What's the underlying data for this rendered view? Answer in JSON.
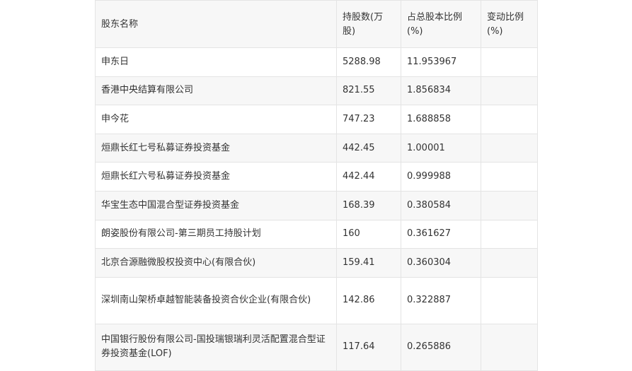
{
  "table": {
    "headers": [
      "股东名称",
      "持股数(万股)",
      "占总股本比例(%)",
      "变动比例(%)"
    ],
    "rows": [
      {
        "name": "申东日",
        "shares": "5288.98",
        "ratio": "11.953967",
        "change": ""
      },
      {
        "name": "香港中央结算有限公司",
        "shares": "821.55",
        "ratio": "1.856834",
        "change": ""
      },
      {
        "name": "申今花",
        "shares": "747.23",
        "ratio": "1.688858",
        "change": ""
      },
      {
        "name": "烜鼎长红七号私募证券投资基金",
        "shares": "442.45",
        "ratio": "1.00001",
        "change": ""
      },
      {
        "name": "烜鼎长红六号私募证券投资基金",
        "shares": "442.44",
        "ratio": "0.999988",
        "change": ""
      },
      {
        "name": "华宝生态中国混合型证券投资基金",
        "shares": "168.39",
        "ratio": "0.380584",
        "change": ""
      },
      {
        "name": "朗姿股份有限公司-第三期员工持股计划",
        "shares": "160",
        "ratio": "0.361627",
        "change": ""
      },
      {
        "name": "北京合源融微股权投资中心(有限合伙)",
        "shares": "159.41",
        "ratio": "0.360304",
        "change": ""
      },
      {
        "name": "深圳南山架桥卓越智能装备投资合伙企业(有限合伙)",
        "shares": "142.86",
        "ratio": "0.322887",
        "change": ""
      },
      {
        "name": "中国银行股份有限公司-国投瑞银瑞利灵活配置混合型证券投资基金(LOF)",
        "shares": "117.64",
        "ratio": "0.265886",
        "change": ""
      }
    ]
  }
}
